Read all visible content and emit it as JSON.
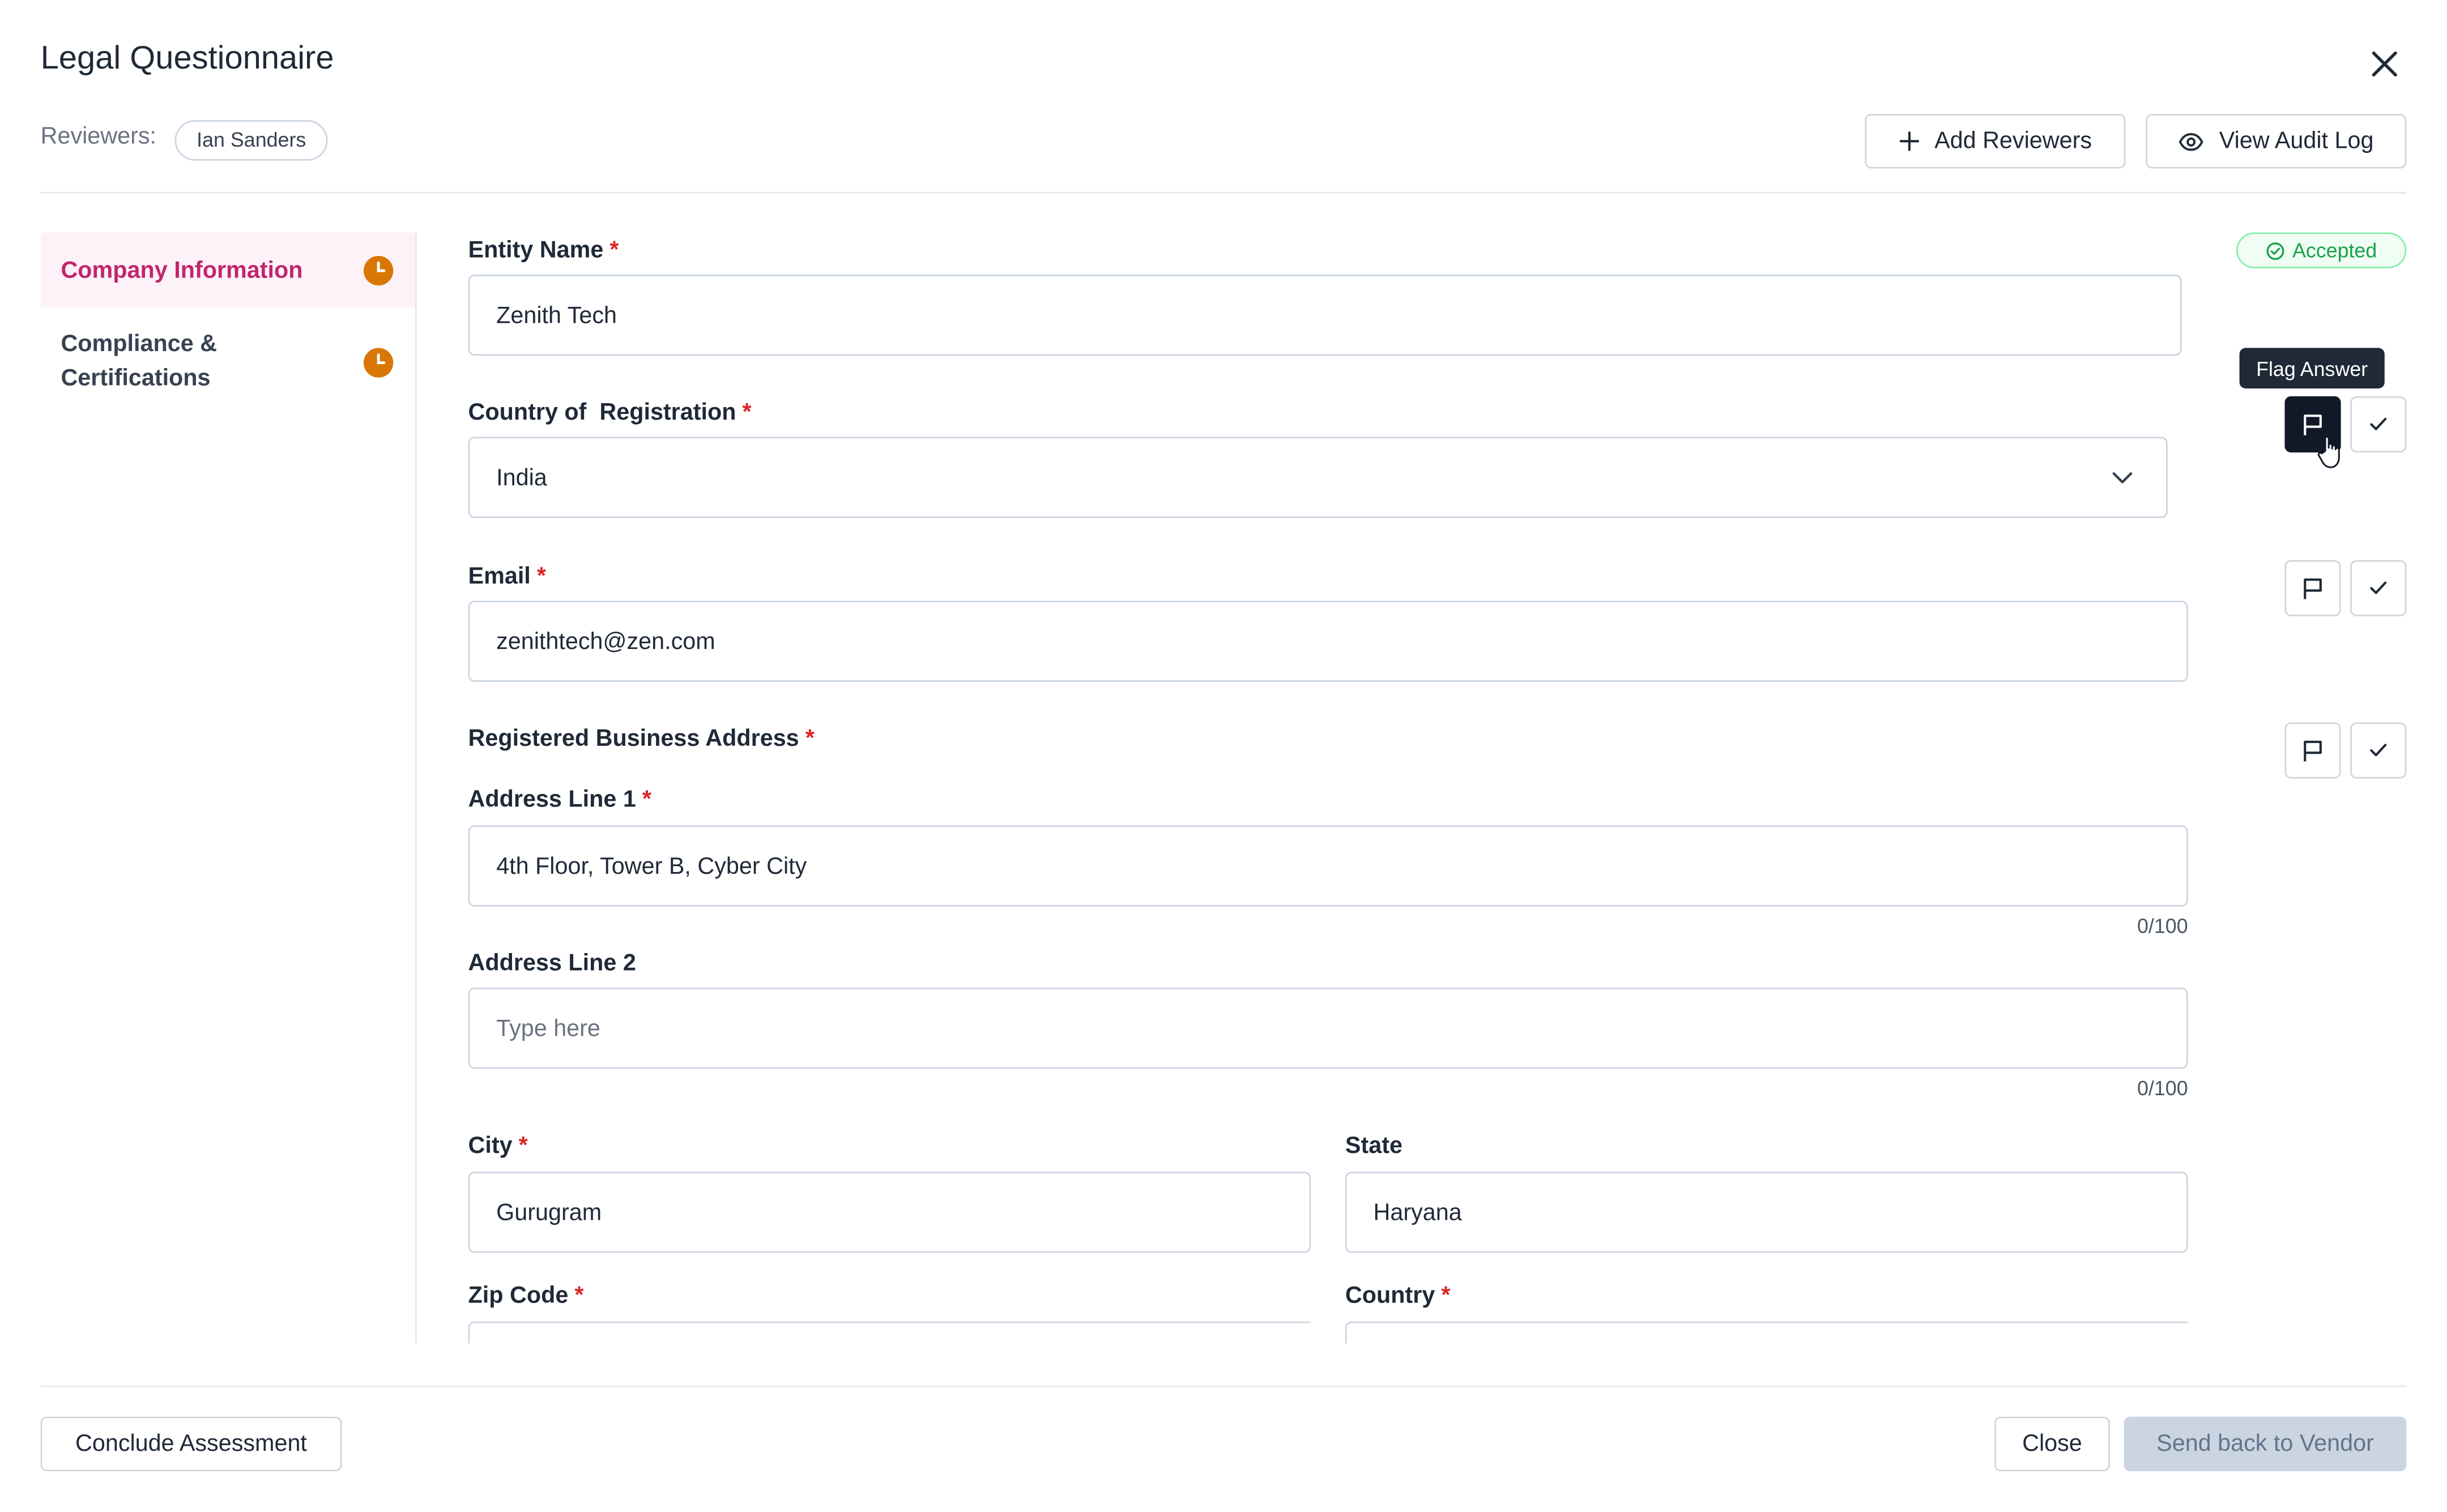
{
  "dialog": {
    "title": "Legal Questionnaire"
  },
  "reviewers": {
    "label": "Reviewers:",
    "names": [
      "Ian Sanders"
    ]
  },
  "header_actions": {
    "add_reviewers": "Add Reviewers",
    "view_audit_log": "View Audit Log"
  },
  "sidebar": {
    "items": [
      {
        "label": "Company Information",
        "active": true,
        "status_icon": "clock-icon"
      },
      {
        "label": "Compliance & Certifications",
        "active": false,
        "status_icon": "clock-icon"
      }
    ]
  },
  "status_badge": "Accepted",
  "tooltip": "Flag Answer",
  "form": {
    "required_marker": "*",
    "entity_name": {
      "label": "Entity Name",
      "value": "Zenith Tech"
    },
    "country_of_registration": {
      "label": "Country of  Registration",
      "value": "India"
    },
    "email": {
      "label": "Email",
      "value": "zenithtech@zen.com"
    },
    "registered_address": {
      "label": "Registered Business Address"
    },
    "address_line_1": {
      "label": "Address Line 1",
      "value": "4th Floor, Tower B, Cyber City",
      "counter": "0/100"
    },
    "address_line_2": {
      "label": "Address Line 2",
      "placeholder": "Type here",
      "counter": "0/100"
    },
    "city": {
      "label": "City",
      "value": "Gurugram"
    },
    "state": {
      "label": "State",
      "value": "Haryana"
    },
    "zip_code": {
      "label": "Zip Code"
    },
    "country": {
      "label": "Country"
    }
  },
  "footer": {
    "conclude": "Conclude Assessment",
    "close": "Close",
    "send_back": "Send back to Vendor"
  },
  "colors": {
    "accent": "#c0266d",
    "accent_bg": "#fdf2f8",
    "pending": "#d97706",
    "accepted": "#16a34a",
    "required": "#dc2626"
  }
}
